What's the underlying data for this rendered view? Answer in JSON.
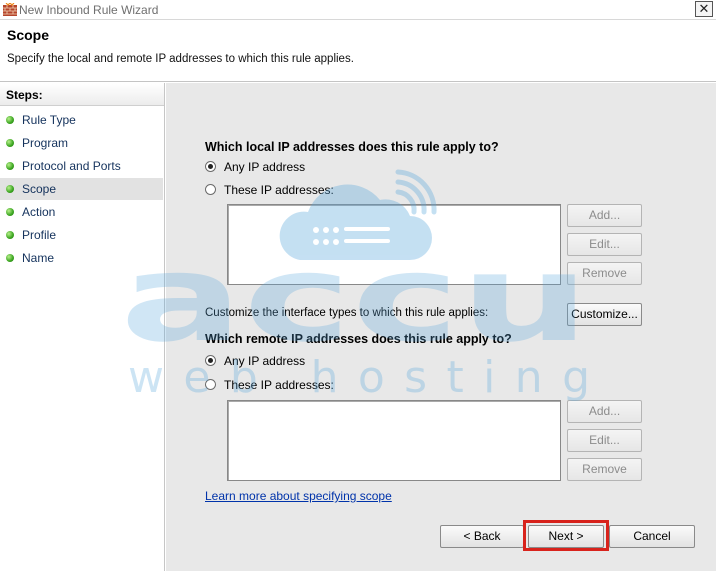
{
  "window": {
    "title": "New Inbound Rule Wizard",
    "close_glyph": "✕"
  },
  "header": {
    "title": "Scope",
    "description": "Specify the local and remote IP addresses to which this rule applies."
  },
  "steps": {
    "heading": "Steps:",
    "items": [
      {
        "label": "Rule Type"
      },
      {
        "label": "Program"
      },
      {
        "label": "Protocol and Ports"
      },
      {
        "label": "Scope",
        "active": true
      },
      {
        "label": "Action"
      },
      {
        "label": "Profile"
      },
      {
        "label": "Name"
      }
    ]
  },
  "local": {
    "question": "Which local IP addresses does this rule apply to?",
    "any_label": "Any IP address",
    "these_label": "These IP addresses:",
    "selected": "any",
    "add_label": "Add...",
    "edit_label": "Edit...",
    "remove_label": "Remove"
  },
  "interface": {
    "text": "Customize the interface types to which this rule applies:",
    "button_label": "Customize..."
  },
  "remote": {
    "question": "Which remote IP addresses does this rule apply to?",
    "any_label": "Any IP address",
    "these_label": "These IP addresses:",
    "selected": "any",
    "add_label": "Add...",
    "edit_label": "Edit...",
    "remove_label": "Remove"
  },
  "learn_more": "Learn more about specifying scope",
  "footer": {
    "back_label": "< Back",
    "next_label": "Next >",
    "cancel_label": "Cancel"
  },
  "watermark": {
    "brand_text": "accu",
    "tagline": "web hosting"
  },
  "colors": {
    "highlight": "#d8231c",
    "step_dot": "#3aa420",
    "link": "#0033aa",
    "watermark": "#5aa7dc"
  }
}
